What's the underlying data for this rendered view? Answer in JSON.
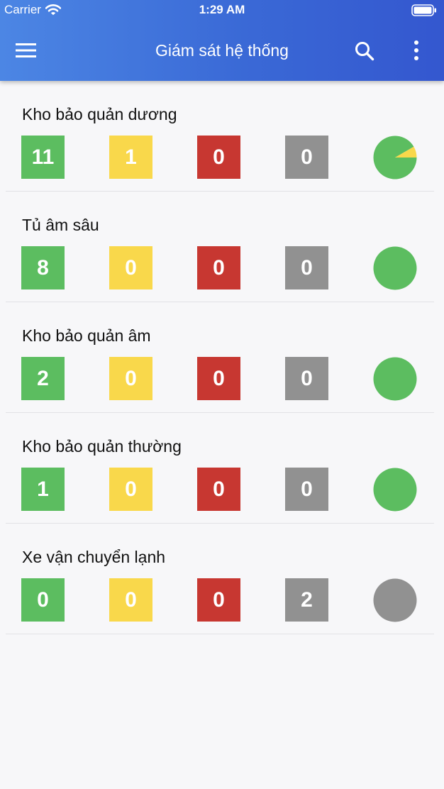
{
  "status_bar": {
    "carrier": "Carrier",
    "time": "1:29 AM"
  },
  "header": {
    "title": "Giám sát hệ thống",
    "icons": [
      "menu-icon",
      "search-icon",
      "more-vertical-icon"
    ]
  },
  "colors": {
    "header_start": "#4c86e4",
    "header_end": "#3457cf",
    "ok": "#5cbd60",
    "warning": "#f9d84b",
    "alarm": "#c73731",
    "offline": "#919191"
  },
  "groups": [
    {
      "name": "Kho bảo quản dương",
      "ok": "11",
      "warning": "1",
      "alarm": "0",
      "offline": "0"
    },
    {
      "name": "Tủ âm sâu",
      "ok": "8",
      "warning": "0",
      "alarm": "0",
      "offline": "0"
    },
    {
      "name": "Kho bảo quản âm",
      "ok": "2",
      "warning": "0",
      "alarm": "0",
      "offline": "0"
    },
    {
      "name": "Kho bảo quản thường",
      "ok": "1",
      "warning": "0",
      "alarm": "0",
      "offline": "0"
    },
    {
      "name": "Xe vận chuyển lạnh",
      "ok": "0",
      "warning": "0",
      "alarm": "0",
      "offline": "2"
    }
  ]
}
